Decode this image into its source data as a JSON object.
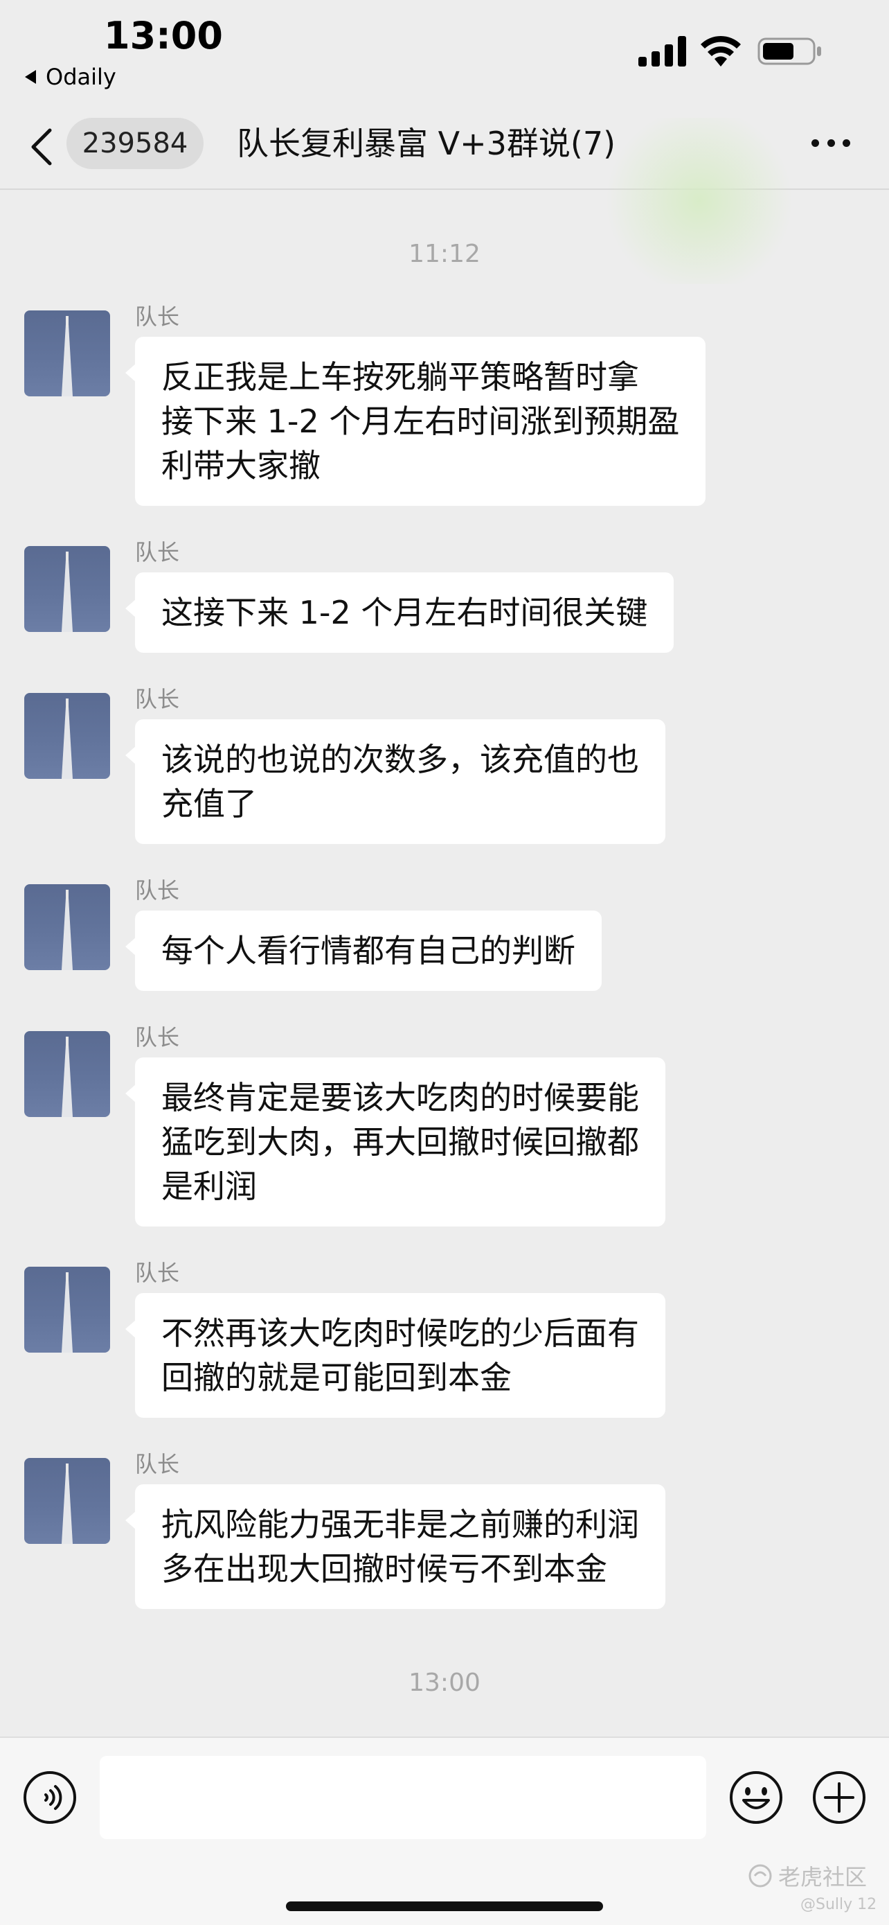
{
  "status_bar": {
    "time": "13:00",
    "back_app": "Odaily"
  },
  "header": {
    "unread_count": "239584",
    "title": "队长复利暴富 V+3群说(7)"
  },
  "messages": [
    {
      "type": "timestamp",
      "text": "11:12"
    },
    {
      "sender": "队长",
      "text": "反正我是上车按死躺平策略暂时拿\n接下来 1-2 个月左右时间涨到预期盈\n利带大家撤"
    },
    {
      "sender": "队长",
      "text": "这接下来 1-2 个月左右时间很关键"
    },
    {
      "sender": "队长",
      "text": "该说的也说的次数多，该充值的也\n充值了"
    },
    {
      "sender": "队长",
      "text": "每个人看行情都有自己的判断"
    },
    {
      "sender": "队长",
      "text": "最终肯定是要该大吃肉的时候要能\n猛吃到大肉，再大回撤时候回撤都\n是利润"
    },
    {
      "sender": "队长",
      "text": "不然再该大吃肉时候吃的少后面有\n回撤的就是可能回到本金"
    },
    {
      "sender": "队长",
      "text": "抗风险能力强无非是之前赚的利润\n多在出现大回撤时候亏不到本金"
    },
    {
      "type": "timestamp",
      "text": "13:00"
    }
  ],
  "input_bar": {
    "placeholder": "",
    "value": ""
  },
  "icons": {
    "voice": "voice-icon",
    "emoji": "emoji-icon",
    "plus": "plus-icon",
    "more": "more-icon",
    "back": "chevron-left-icon"
  },
  "watermark": {
    "text": "老虎社区",
    "sub": "@Sully 12"
  },
  "colors": {
    "background": "#ededed",
    "bubble": "#ffffff",
    "avatar": "#5d6e95"
  }
}
